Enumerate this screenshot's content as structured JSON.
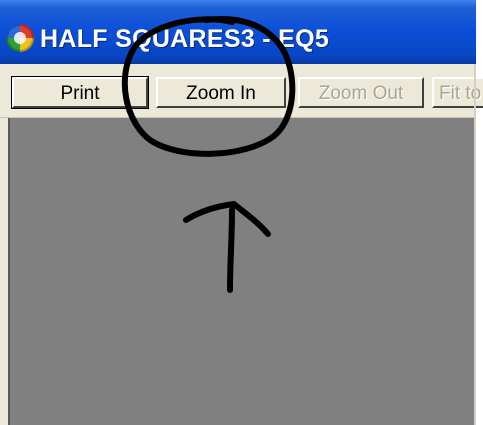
{
  "window": {
    "title": "HALF SQUARES3 - EQ5",
    "icon": "app-logo-icon"
  },
  "toolbar": {
    "buttons": [
      {
        "label": "Print",
        "enabled": true
      },
      {
        "label": "Zoom In",
        "enabled": true
      },
      {
        "label": "Zoom Out",
        "enabled": false
      },
      {
        "label": "Fit to",
        "enabled": false
      }
    ]
  },
  "annotation": {
    "color": "#000000",
    "shapes": [
      "hand-drawn-circle",
      "hand-drawn-up-arrow"
    ]
  },
  "colors": {
    "titlebar": "#0a4ed8",
    "canvas": "#808080",
    "chrome": "#ece9d8"
  }
}
